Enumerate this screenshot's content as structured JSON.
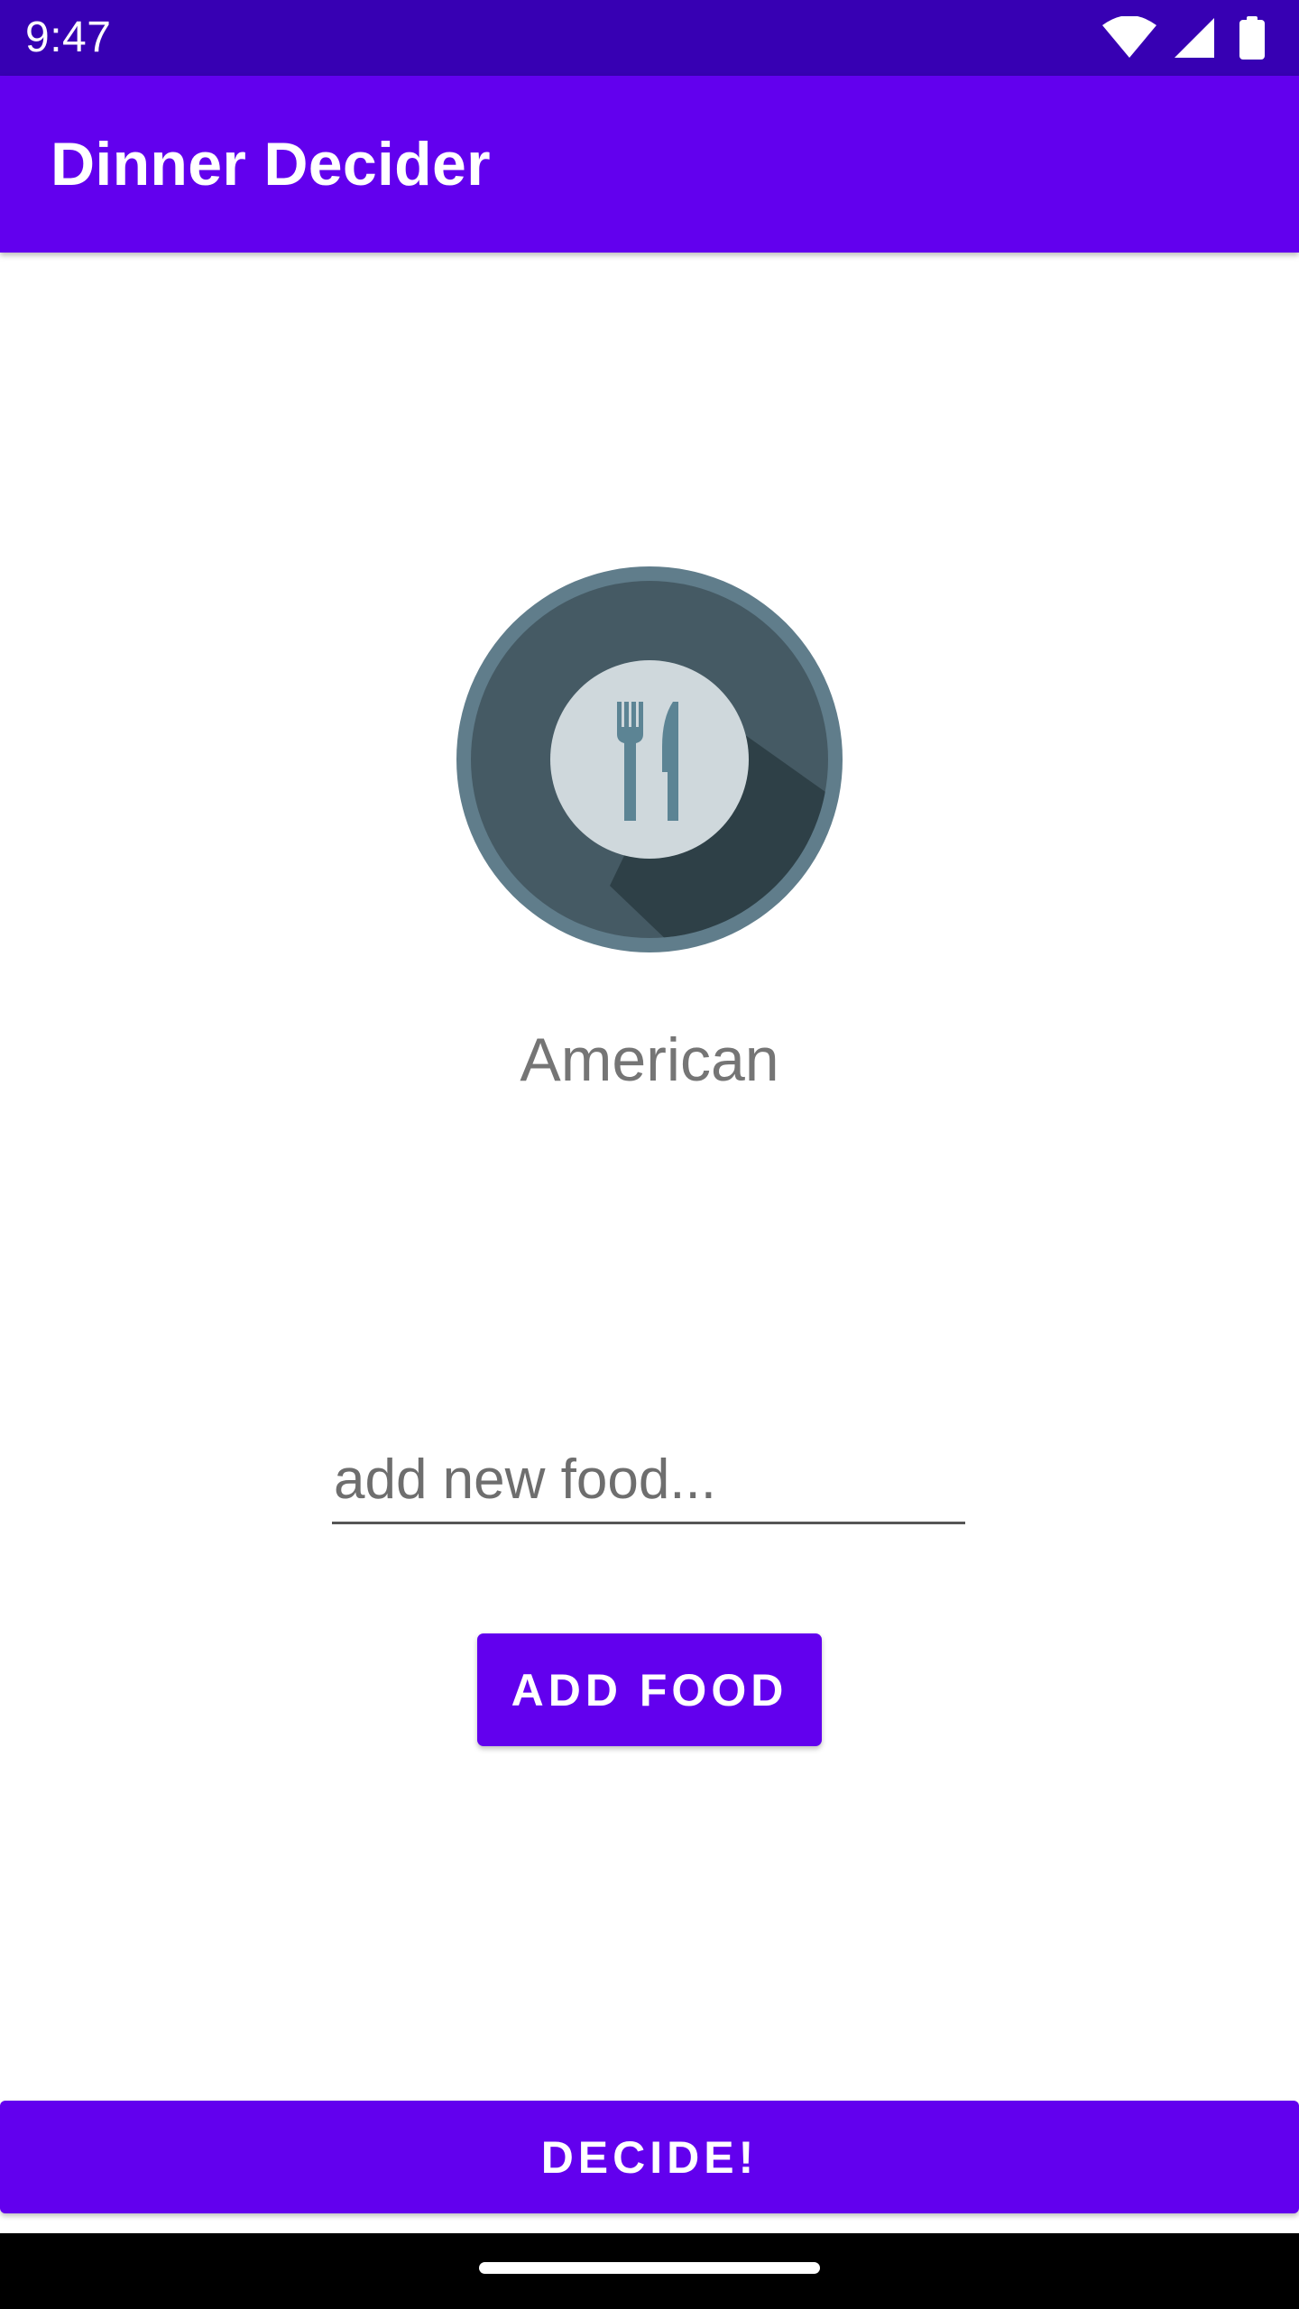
{
  "status_bar": {
    "time": "9:47",
    "icons": [
      "wifi-icon",
      "signal-icon",
      "battery-icon"
    ]
  },
  "app_bar": {
    "title": "Dinner Decider"
  },
  "main": {
    "image_icon": "plate-fork-knife-icon",
    "food_name": "American",
    "input": {
      "value": "",
      "placeholder": "add new food..."
    },
    "add_button_label": "ADD FOOD",
    "decide_button_label": "DECIDE!"
  },
  "colors": {
    "primary": "#6200ee",
    "primary_dark": "#3700b3",
    "food_text": "#757575",
    "plate_ring": "#607d8b",
    "plate_inner": "#455a64",
    "plate_center": "#cfd8dc"
  }
}
